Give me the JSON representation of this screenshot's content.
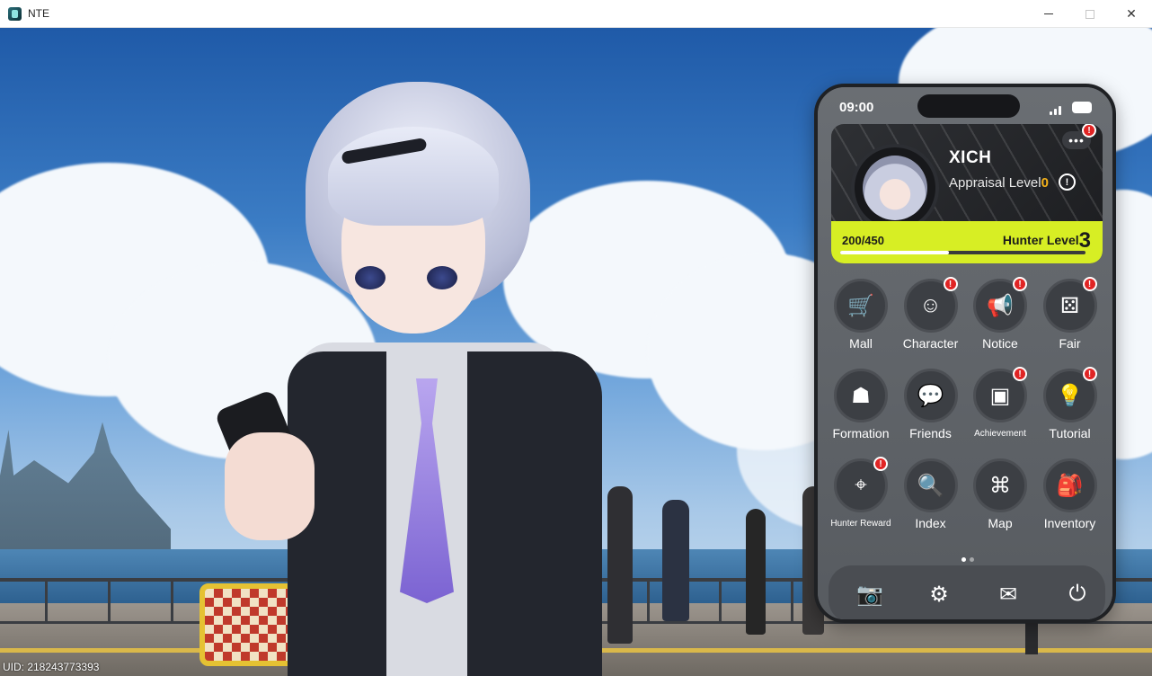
{
  "window": {
    "title": "NTE",
    "controls": {
      "minimize": "—",
      "maximize": "☐",
      "close": "✕"
    }
  },
  "hud": {
    "uid": "UID: 218243773393"
  },
  "phone": {
    "time": "09:00",
    "profile": {
      "name": "XICH",
      "appraisal_label": "Appraisal Level",
      "appraisal_value": "0",
      "xp_text": "200/450",
      "xp_fraction": 0.444,
      "hunter_label": "Hunter Level",
      "hunter_value": "3",
      "more_icon": "ellipsis-icon",
      "info_icon": "info-icon",
      "has_alert": true
    },
    "apps": [
      {
        "label": "Mall",
        "icon": "cart-icon",
        "badge": false
      },
      {
        "label": "Character",
        "icon": "character-icon",
        "badge": true
      },
      {
        "label": "Notice",
        "icon": "megaphone-icon",
        "badge": true
      },
      {
        "label": "Fair",
        "icon": "dice-icon",
        "badge": true
      },
      {
        "label": "Formation",
        "icon": "formation-icon",
        "badge": false
      },
      {
        "label": "Friends",
        "icon": "chat-icon",
        "badge": false
      },
      {
        "label": "Achievement",
        "icon": "achievement-icon",
        "badge": true
      },
      {
        "label": "Tutorial",
        "icon": "bulb-icon",
        "badge": true
      },
      {
        "label": "Hunter Reward",
        "icon": "crosshair-icon",
        "badge": true
      },
      {
        "label": "Index",
        "icon": "index-icon",
        "badge": false
      },
      {
        "label": "Map",
        "icon": "map-icon",
        "badge": false
      },
      {
        "label": "Inventory",
        "icon": "backpack-icon",
        "badge": false
      }
    ],
    "page_indicator": {
      "pages": 2,
      "current": 1
    },
    "dock": [
      {
        "icon": "camera-icon",
        "glyph": "📷"
      },
      {
        "icon": "gear-icon",
        "glyph": "⚙"
      },
      {
        "icon": "mail-icon",
        "glyph": "✉"
      },
      {
        "icon": "power-icon",
        "glyph": "⏻"
      }
    ],
    "colors": {
      "accent": "#d7ee24",
      "badge": "#e02424",
      "appraisal": "#f5b21a"
    }
  }
}
